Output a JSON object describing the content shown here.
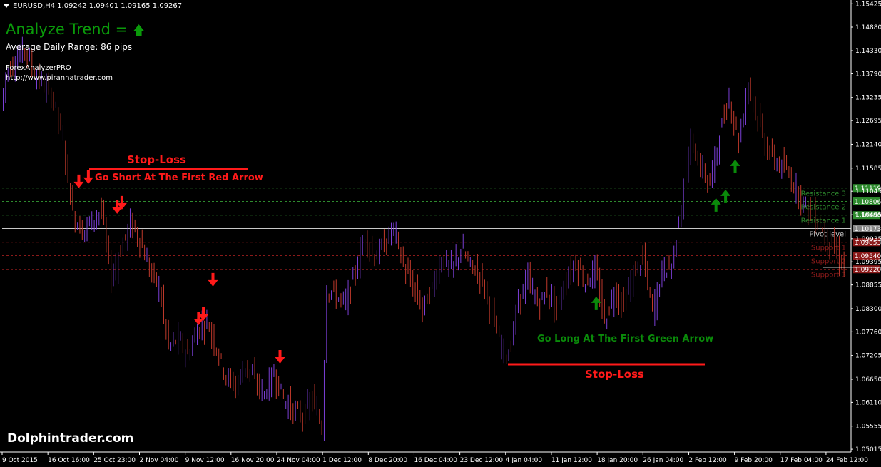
{
  "header": {
    "symbol_line": "EURUSD,H4  1.09242 1.09401 1.09165 1.09267",
    "trend_label": "Analyze Trend = ",
    "trend_arrow": "🡅",
    "adr_label": "Average Daily Range: 86 pips",
    "brand": "ForexAnalyzerPRO",
    "brand_url": "http://www.piranhatrader.com"
  },
  "annotations": {
    "short_sl": "Stop-Loss",
    "short_entry": "Go Short At The First Red Arrow",
    "long_entry": "Go Long At The First Green Arrow",
    "long_sl": "Stop-Loss"
  },
  "watermark": "Dolphintrader.com",
  "levels": [
    {
      "label": "Resistance 3",
      "value": "1.11119",
      "color": "#2e8b2e"
    },
    {
      "label": "Resistance 2",
      "value": "1.10806",
      "color": "#2e8b2e"
    },
    {
      "label": "Resistance 1",
      "value": "1.10486",
      "color": "#2e8b2e"
    },
    {
      "label": "Pivot level",
      "value": "1.10173",
      "color": "#c8c8c8"
    },
    {
      "label": "Support 1",
      "value": "1.09853",
      "color": "#8b1a1a"
    },
    {
      "label": "Support 2",
      "value": "1.09540",
      "color": "#8b1a1a"
    },
    {
      "label": "Support 3",
      "value": "1.09220",
      "color": "#8b1a1a"
    }
  ],
  "current_price": "1.09267",
  "colors": {
    "candle_up": "#7b3fd6",
    "candle_down": "#c0392b",
    "sell_arrow": "#ff1a1a",
    "buy_arrow": "#0a8a0a",
    "axis": "#ffffff"
  },
  "chart_data": {
    "type": "line",
    "title": "EURUSD,H4",
    "y_axis_ticks": [
      "1.15425",
      "1.14880",
      "1.14330",
      "1.13790",
      "1.13235",
      "1.12695",
      "1.12140",
      "1.11585",
      "1.11045",
      "1.10495",
      "1.09935",
      "1.09395",
      "1.08855",
      "1.08300",
      "1.07760",
      "1.07205",
      "1.06650",
      "1.06110",
      "1.05555",
      "1.05015"
    ],
    "x_axis_ticks": [
      "9 Oct 2015",
      "16 Oct 16:00",
      "25 Oct 23:00",
      "2 Nov 04:00",
      "9 Nov 12:00",
      "16 Nov 20:00",
      "24 Nov 04:00",
      "1 Dec 12:00",
      "8 Dec 20:00",
      "16 Dec 04:00",
      "23 Dec 12:00",
      "4 Jan 04:00",
      "11 Jan 12:00",
      "18 Jan 20:00",
      "26 Jan 04:00",
      "2 Feb 12:00",
      "9 Feb 20:00",
      "17 Feb 04:00",
      "24 Feb 12:00"
    ],
    "ylim": [
      1.0495,
      1.1548
    ],
    "close_series": [
      {
        "t": 0,
        "v": 1.13
      },
      {
        "t": 1,
        "v": 1.138
      },
      {
        "t": 3,
        "v": 1.141
      },
      {
        "t": 5,
        "v": 1.144
      },
      {
        "t": 7,
        "v": 1.138
      },
      {
        "t": 9,
        "v": 1.135
      },
      {
        "t": 11,
        "v": 1.132
      },
      {
        "t": 13,
        "v": 1.122
      },
      {
        "t": 15,
        "v": 1.105
      },
      {
        "t": 17,
        "v": 1.101
      },
      {
        "t": 19,
        "v": 1.104
      },
      {
        "t": 21,
        "v": 1.106
      },
      {
        "t": 23,
        "v": 1.09
      },
      {
        "t": 25,
        "v": 1.097
      },
      {
        "t": 27,
        "v": 1.103
      },
      {
        "t": 29,
        "v": 1.099
      },
      {
        "t": 31,
        "v": 1.092
      },
      {
        "t": 33,
        "v": 1.088
      },
      {
        "t": 35,
        "v": 1.074
      },
      {
        "t": 37,
        "v": 1.076
      },
      {
        "t": 39,
        "v": 1.072
      },
      {
        "t": 41,
        "v": 1.078
      },
      {
        "t": 43,
        "v": 1.08
      },
      {
        "t": 45,
        "v": 1.074
      },
      {
        "t": 47,
        "v": 1.067
      },
      {
        "t": 49,
        "v": 1.065
      },
      {
        "t": 51,
        "v": 1.07
      },
      {
        "t": 53,
        "v": 1.066
      },
      {
        "t": 55,
        "v": 1.063
      },
      {
        "t": 57,
        "v": 1.068
      },
      {
        "t": 59,
        "v": 1.062
      },
      {
        "t": 61,
        "v": 1.059
      },
      {
        "t": 63,
        "v": 1.058
      },
      {
        "t": 65,
        "v": 1.062
      },
      {
        "t": 67,
        "v": 1.055
      },
      {
        "t": 68,
        "v": 1.088
      },
      {
        "t": 70,
        "v": 1.086
      },
      {
        "t": 72,
        "v": 1.084
      },
      {
        "t": 74,
        "v": 1.092
      },
      {
        "t": 76,
        "v": 1.1
      },
      {
        "t": 78,
        "v": 1.095
      },
      {
        "t": 80,
        "v": 1.098
      },
      {
        "t": 82,
        "v": 1.102
      },
      {
        "t": 84,
        "v": 1.093
      },
      {
        "t": 86,
        "v": 1.088
      },
      {
        "t": 88,
        "v": 1.083
      },
      {
        "t": 90,
        "v": 1.088
      },
      {
        "t": 92,
        "v": 1.095
      },
      {
        "t": 94,
        "v": 1.092
      },
      {
        "t": 96,
        "v": 1.097
      },
      {
        "t": 98,
        "v": 1.093
      },
      {
        "t": 100,
        "v": 1.091
      },
      {
        "t": 102,
        "v": 1.084
      },
      {
        "t": 104,
        "v": 1.075
      },
      {
        "t": 106,
        "v": 1.072
      },
      {
        "t": 108,
        "v": 1.085
      },
      {
        "t": 110,
        "v": 1.09
      },
      {
        "t": 112,
        "v": 1.084
      },
      {
        "t": 114,
        "v": 1.087
      },
      {
        "t": 116,
        "v": 1.083
      },
      {
        "t": 118,
        "v": 1.09
      },
      {
        "t": 120,
        "v": 1.094
      },
      {
        "t": 122,
        "v": 1.089
      },
      {
        "t": 124,
        "v": 1.092
      },
      {
        "t": 126,
        "v": 1.08
      },
      {
        "t": 128,
        "v": 1.087
      },
      {
        "t": 130,
        "v": 1.084
      },
      {
        "t": 132,
        "v": 1.091
      },
      {
        "t": 134,
        "v": 1.095
      },
      {
        "t": 136,
        "v": 1.082
      },
      {
        "t": 138,
        "v": 1.092
      },
      {
        "t": 140,
        "v": 1.093
      },
      {
        "t": 142,
        "v": 1.108
      },
      {
        "t": 144,
        "v": 1.122
      },
      {
        "t": 146,
        "v": 1.116
      },
      {
        "t": 148,
        "v": 1.112
      },
      {
        "t": 150,
        "v": 1.124
      },
      {
        "t": 152,
        "v": 1.132
      },
      {
        "t": 154,
        "v": 1.122
      },
      {
        "t": 156,
        "v": 1.136
      },
      {
        "t": 158,
        "v": 1.127
      },
      {
        "t": 160,
        "v": 1.12
      },
      {
        "t": 162,
        "v": 1.117
      },
      {
        "t": 164,
        "v": 1.115
      },
      {
        "t": 166,
        "v": 1.111
      },
      {
        "t": 168,
        "v": 1.107
      },
      {
        "t": 170,
        "v": 1.104
      },
      {
        "t": 172,
        "v": 1.1
      },
      {
        "t": 174,
        "v": 1.097
      },
      {
        "t": 176,
        "v": 1.0927
      }
    ],
    "sell_signals": [
      {
        "t": 16,
        "v": 1.112
      },
      {
        "t": 18,
        "v": 1.113
      },
      {
        "t": 24,
        "v": 1.106
      },
      {
        "t": 25,
        "v": 1.107
      },
      {
        "t": 41,
        "v": 1.08
      },
      {
        "t": 42,
        "v": 1.081
      },
      {
        "t": 44,
        "v": 1.089
      },
      {
        "t": 58,
        "v": 1.071
      }
    ],
    "buy_signals": [
      {
        "t": 124,
        "v": 1.085
      },
      {
        "t": 149,
        "v": 1.108
      },
      {
        "t": 151,
        "v": 1.11
      },
      {
        "t": 153,
        "v": 1.117
      }
    ]
  }
}
